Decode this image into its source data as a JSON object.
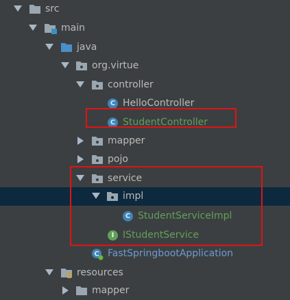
{
  "colors": {
    "background": "#3c3f41",
    "selected_row": "#0d293e",
    "highlight_border": "#e01414",
    "text_default": "#bbbbbb",
    "text_modified": "#62a05a",
    "text_application": "#6c9bd2",
    "class_icon": "#3f83b5",
    "interface_icon": "#62a05a"
  },
  "icons": {
    "class_letter": "C",
    "interface_letter": "I"
  },
  "tree": {
    "src": "src",
    "main": "main",
    "java": "java",
    "org_virtue": "org.virtue",
    "controller": "controller",
    "hello_controller": "HelloController",
    "student_controller": "StudentController",
    "mapper": "mapper",
    "pojo": "pojo",
    "service": "service",
    "impl": "impl",
    "student_service_impl": "StudentServiceImpl",
    "istudent_service": "IStudentService",
    "fast_springboot_application": "FastSpringbootApplication",
    "resources": "resources",
    "resources_mapper": "mapper"
  }
}
